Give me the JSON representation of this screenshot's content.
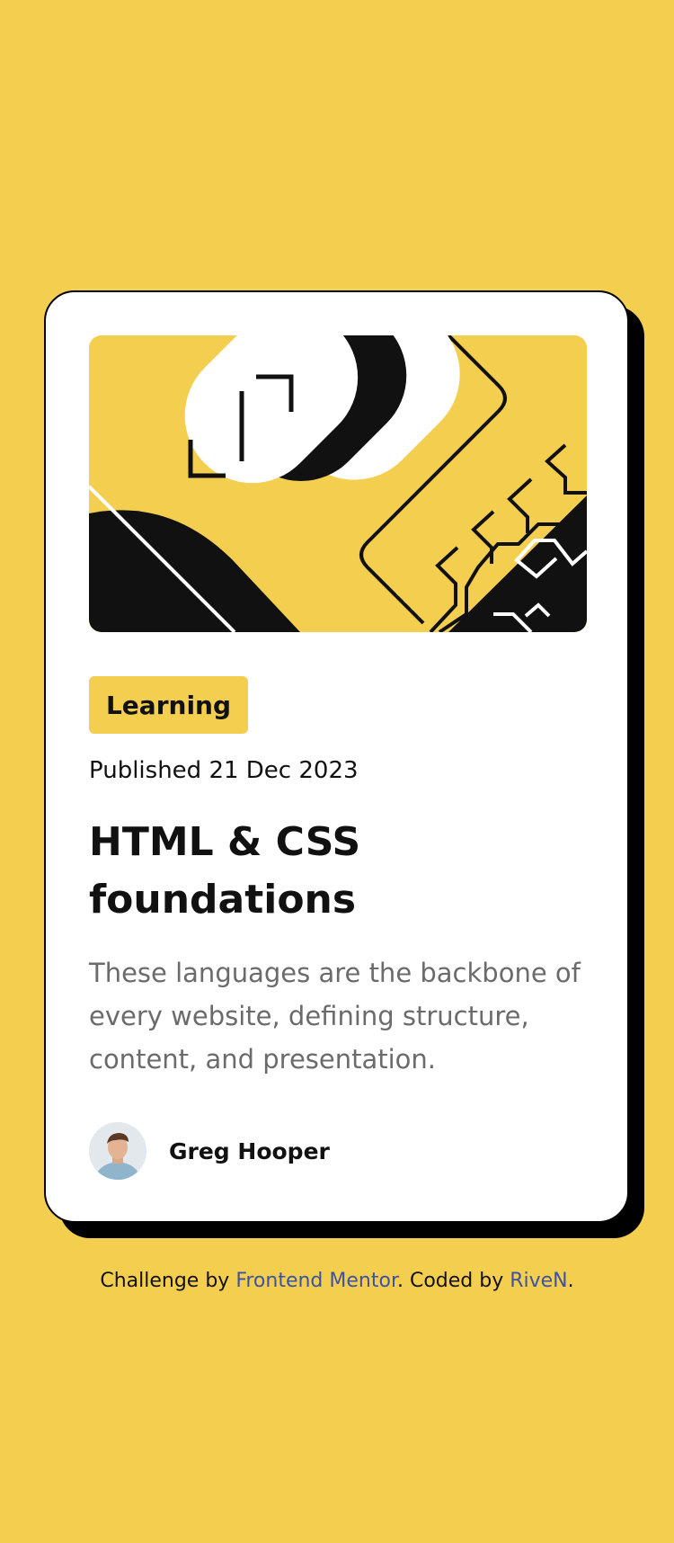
{
  "colors": {
    "background": "#F4CF4F",
    "card": "#FFFFFF",
    "ink": "#111111",
    "muted_text": "#6B6B6B",
    "link": "#3E52A3"
  },
  "card": {
    "hero_image": "abstract-illustration",
    "tag": "Learning",
    "published": "Published 21 Dec 2023",
    "title": "HTML & CSS foundations",
    "description": "These languages are the backbone of every website, defining structure, content, and presentation.",
    "author": {
      "avatar": "avatar-photo",
      "name": "Greg Hooper"
    }
  },
  "attribution": {
    "prefix": "Challenge by ",
    "challenge_link": "Frontend Mentor",
    "middle": ". Coded by ",
    "coder_link": "RiveN",
    "suffix": "."
  }
}
